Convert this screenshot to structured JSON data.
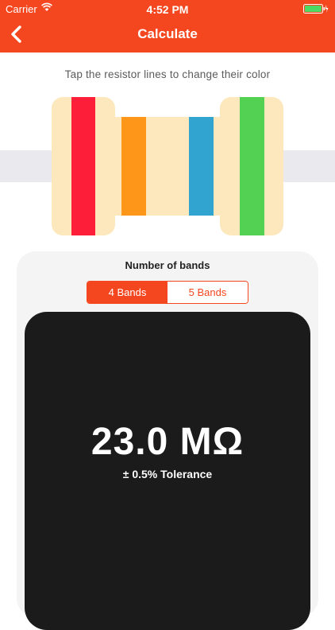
{
  "status_bar": {
    "carrier": "Carrier",
    "time": "4:52 PM"
  },
  "header": {
    "title": "Calculate",
    "back_icon": "chevron-left-icon",
    "color": "#f5471f"
  },
  "instruction": "Tap the resistor lines to change their color",
  "resistor": {
    "body_color": "#fce8bc",
    "bands": [
      {
        "name": "band-1",
        "color": "#fd1f3a"
      },
      {
        "name": "band-2",
        "color": "#fd9619"
      },
      {
        "name": "band-3",
        "color": "#31a5cf"
      },
      {
        "name": "band-4",
        "color": "#52d152"
      }
    ]
  },
  "bands_selector": {
    "label": "Number of bands",
    "options": [
      "4 Bands",
      "5 Bands"
    ],
    "selected": "4 Bands"
  },
  "result": {
    "value": "23.0 MΩ",
    "tolerance": "± 0.5% Tolerance"
  }
}
